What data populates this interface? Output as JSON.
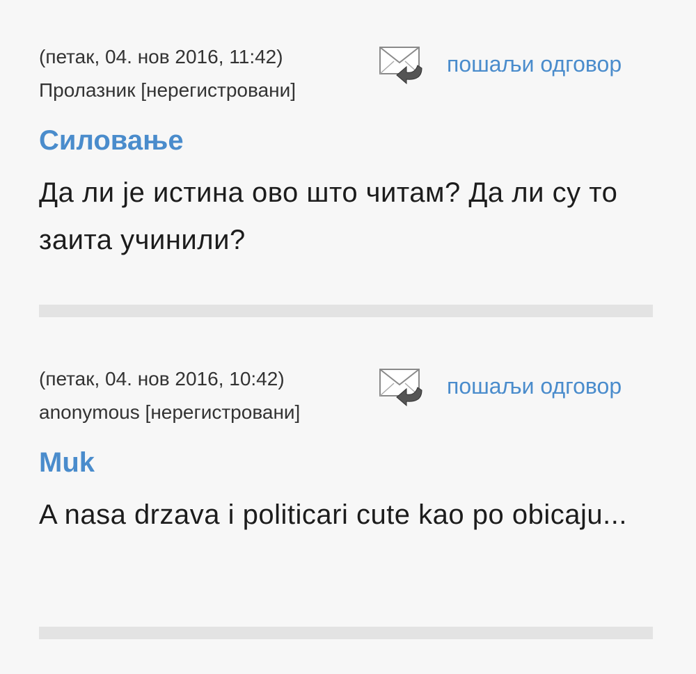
{
  "comments": [
    {
      "date": "(петак, 04. нов 2016, 11:42)",
      "author": "Пролазник [нерегистровани]",
      "reply_label": "пошаљи одговор",
      "reply_icon": "mail-reply-icon",
      "title": "Силовање",
      "body": "Да ли је истина ово што читам? Да ли су то заита учинили?"
    },
    {
      "date": "(петак, 04. нов 2016, 10:42)",
      "author": "anonymous [нерегистровани]",
      "reply_label": "пошаљи одговор",
      "reply_icon": "mail-reply-icon",
      "title": "Muk",
      "body": "A nasa drzava i politicari cute kao po obicaju..."
    }
  ],
  "colors": {
    "link": "#4a8ccc",
    "background": "#f7f7f7",
    "divider": "#e3e3e3"
  }
}
